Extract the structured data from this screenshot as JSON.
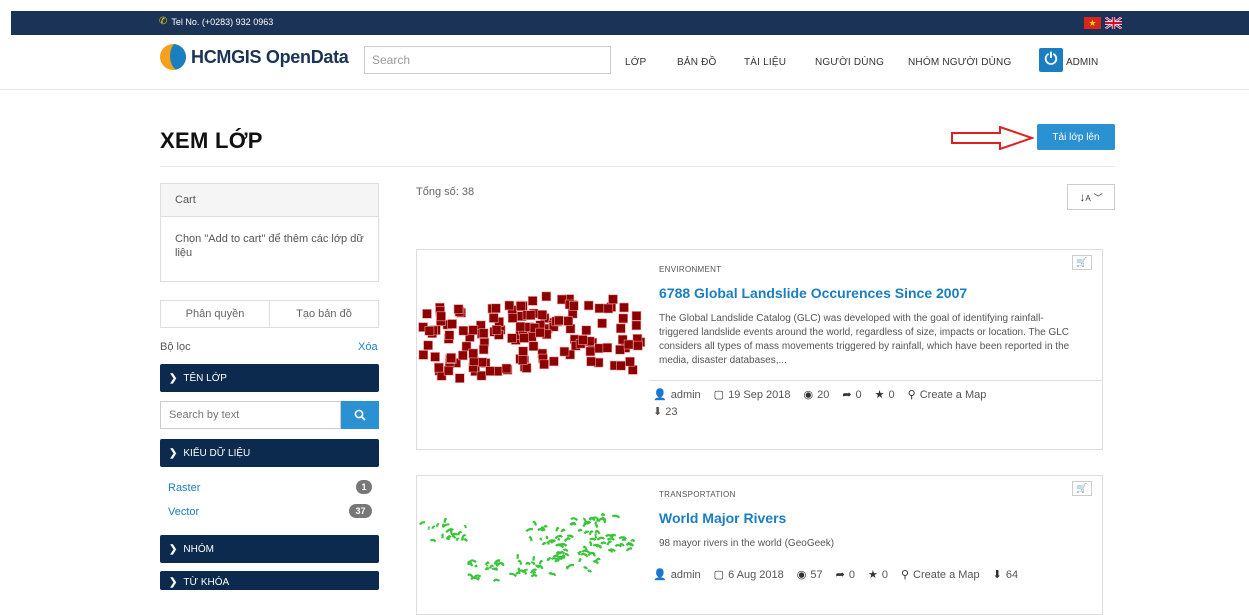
{
  "topbar": {
    "tel": "Tel No. (+0283) 932 0963"
  },
  "header": {
    "logo": "HCMGIS OpenData",
    "search_placeholder": "Search",
    "nav": [
      "LỚP",
      "BẢN ĐỒ",
      "TÀI LIỆU",
      "NGƯỜI DÙNG",
      "NHÓM NGƯỜI DÙNG"
    ],
    "user": "ADMIN"
  },
  "page": {
    "title": "XEM LỚP",
    "upload_label": "Tải lớp lên"
  },
  "sidebar": {
    "cart_title": "Cart",
    "cart_hint": "Chọn \"Add to cart\" để thêm các lớp dữ liệu",
    "tabs": [
      "Phân quyền",
      "Tạo bản đồ"
    ],
    "filter_label": "Bộ lọc",
    "filter_clear": "Xóa",
    "facets": {
      "name": "TÊN LỚP",
      "type": "KIỂU DỮ LIỆU",
      "group": "NHÓM",
      "keyword": "TỪ KHÓA"
    },
    "search_placeholder": "Search by text",
    "types": [
      {
        "label": "Raster",
        "count": "1"
      },
      {
        "label": "Vector",
        "count": "37"
      }
    ]
  },
  "results": {
    "total": "Tổng số: 38",
    "items": [
      {
        "category": "ENVIRONMENT",
        "title": "6788 Global Landslide Occurences Since 2007",
        "description": "The Global Landslide Catalog (GLC) was developed with the goal of identifying rainfall-triggered landslide events around the world, regardless of size, impacts or location. The GLC considers all types of mass movements triggered by rainfall, which have been reported in the media, disaster databases,...",
        "owner": "admin",
        "date": "19 Sep 2018",
        "views": "20",
        "shares": "0",
        "rating": "0",
        "map_action": "Create a Map",
        "downloads": "23"
      },
      {
        "category": "TRANSPORTATION",
        "title": "World Major Rivers",
        "description": "98 mayor rivers in the world (GeoGeek)",
        "owner": "admin",
        "date": "6 Aug 2018",
        "views": "57",
        "shares": "0",
        "rating": "0",
        "map_action": "Create a Map",
        "downloads": "64"
      }
    ]
  },
  "colors": {
    "navy": "#1b3356",
    "accent": "#2a91d2",
    "landslide": "#8b0000",
    "rivers": "#3ac43a",
    "arrow": "#e02020"
  }
}
